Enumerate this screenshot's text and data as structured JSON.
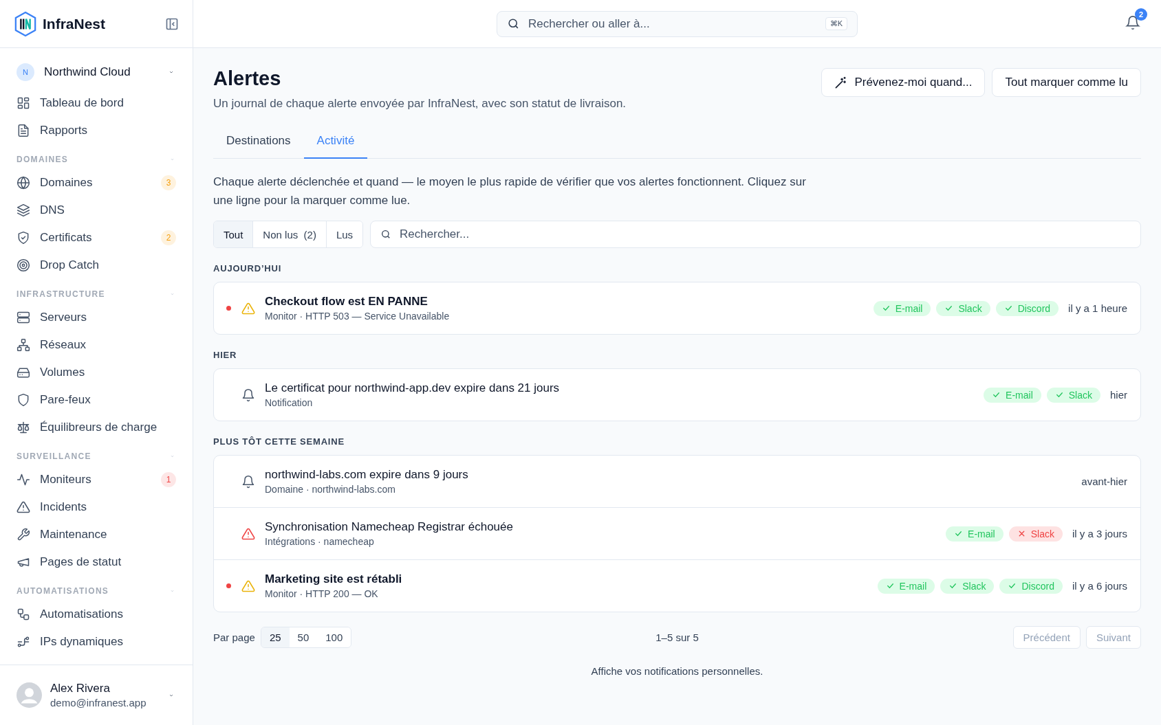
{
  "sidebar": {
    "brand": "InfraNest",
    "workspace": {
      "initial": "N",
      "name": "Northwind Cloud"
    },
    "top_items": [
      {
        "label": "Tableau de bord"
      },
      {
        "label": "Rapports"
      }
    ],
    "sections": [
      {
        "title": "DOMAINES",
        "expanded": true,
        "items": [
          {
            "label": "Domaines",
            "badge": "3",
            "color": "#f59e0b"
          },
          {
            "label": "DNS"
          },
          {
            "label": "Certificats",
            "badge": "2",
            "color": "#f59e0b"
          },
          {
            "label": "Drop Catch"
          }
        ]
      },
      {
        "title": "INFRASTRUCTURE",
        "expanded": true,
        "items": [
          {
            "label": "Serveurs"
          },
          {
            "label": "Réseaux"
          },
          {
            "label": "Volumes"
          },
          {
            "label": "Pare-feux"
          },
          {
            "label": "Équilibreurs de charge"
          }
        ]
      },
      {
        "title": "SURVEILLANCE",
        "expanded": true,
        "items": [
          {
            "label": "Moniteurs",
            "badge": "1",
            "color": "#ef4444"
          },
          {
            "label": "Incidents"
          },
          {
            "label": "Maintenance"
          },
          {
            "label": "Pages de statut"
          }
        ]
      },
      {
        "title": "AUTOMATISATIONS",
        "expanded": true,
        "items": [
          {
            "label": "Automatisations"
          },
          {
            "label": "IPs dynamiques"
          }
        ]
      }
    ],
    "user": {
      "name": "Alex Rivera",
      "email": "demo@infranest.app"
    }
  },
  "topbar": {
    "search": {
      "placeholder": "Rechercher ou aller à...",
      "shortcut": "⌘K"
    },
    "notifications": "2"
  },
  "page": {
    "title": "Alertes",
    "subtitle": "Un journal de chaque alerte envoyée par InfraNest, avec son statut de livraison.",
    "buttons": [
      "Prévenez-moi quand...",
      "Tout marquer comme lu"
    ],
    "tabs": [
      {
        "label": "Destinations",
        "selected": false
      },
      {
        "label": "Activité",
        "selected": true
      }
    ],
    "description": "Chaque alerte déclenchée et quand — le moyen le plus rapide de vérifier que vos alertes fonctionnent. Cliquez sur une ligne pour la marquer comme lue.",
    "filters": [
      {
        "label": "Tout",
        "selected": true
      },
      {
        "label": "Non lus",
        "count": "(2)",
        "selected": false
      },
      {
        "label": "Lus",
        "selected": false
      }
    ],
    "search": {
      "placeholder": "Rechercher..."
    },
    "groups": [
      {
        "title": "AUJOURD’HUI",
        "alerts": [
          {
            "kind": "warning",
            "unread": true,
            "title": "Checkout flow est EN PANNE",
            "subtitle": "Monitor · HTTP 503 — Service Unavailable",
            "channels": [
              {
                "label": "E-mail",
                "ok": true
              },
              {
                "label": "Slack",
                "ok": true
              },
              {
                "label": "Discord",
                "ok": true
              }
            ],
            "time": "il y a 1 heure"
          }
        ]
      },
      {
        "title": "HIER",
        "alerts": [
          {
            "kind": "bell",
            "unread": false,
            "title": "Le certificat pour northwind-app.dev expire dans 21 jours",
            "subtitle": "Notification",
            "channels": [
              {
                "label": "E-mail",
                "ok": true
              },
              {
                "label": "Slack",
                "ok": true
              }
            ],
            "time": "hier"
          }
        ]
      },
      {
        "title": "PLUS TÔT CETTE SEMAINE",
        "alerts": [
          {
            "kind": "bell",
            "unread": false,
            "title": "northwind-labs.com expire dans 9 jours",
            "subtitle": "Domaine · northwind-labs.com",
            "time": "avant-hier"
          },
          {
            "kind": "error",
            "unread": false,
            "title": "Synchronisation Namecheap Registrar échouée",
            "subtitle": "Intégrations · namecheap",
            "channels": [
              {
                "label": "E-mail",
                "ok": true
              },
              {
                "label": "Slack",
                "ok": false
              }
            ],
            "time": "il y a 3 jours"
          },
          {
            "kind": "warning",
            "unread": true,
            "title": "Marketing site est rétabli",
            "subtitle": "Monitor · HTTP 200 — OK",
            "channels": [
              {
                "label": "E-mail",
                "ok": true
              },
              {
                "label": "Slack",
                "ok": true
              },
              {
                "label": "Discord",
                "ok": true
              }
            ],
            "time": "il y a 6 jours"
          }
        ]
      }
    ],
    "pagination": {
      "label": "Par page",
      "sizes": [
        {
          "label": "25",
          "selected": true
        },
        {
          "label": "50",
          "selected": false
        },
        {
          "label": "100",
          "selected": false
        }
      ],
      "range": "1–5 sur 5",
      "prev": {
        "label": "Précédent",
        "disabled": true
      },
      "next": {
        "label": "Suivant",
        "disabled": true
      }
    },
    "footer": "Affiche vos notifications personnelles."
  }
}
